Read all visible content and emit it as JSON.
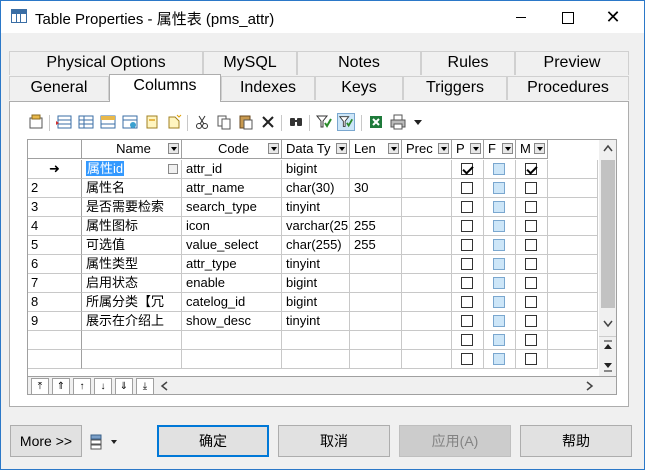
{
  "window": {
    "title": "Table Properties - 属性表 (pms_attr)",
    "close_glyph": "✕"
  },
  "tabs_row1": [
    "Physical Options",
    "MySQL",
    "Notes",
    "Rules",
    "Preview"
  ],
  "tabs_row2": [
    "General",
    "Columns",
    "Indexes",
    "Keys",
    "Triggers",
    "Procedures"
  ],
  "active_tab": "Columns",
  "toolbar_icons": [
    "properties-icon",
    "insert-row-icon",
    "add-row-icon",
    "add-columns-icon",
    "reuse-columns-icon",
    "new-item-icon",
    "cut-icon",
    "copy-icon",
    "paste-icon",
    "delete-icon",
    "find-icon",
    "filter-icon",
    "clear-filter-icon",
    "excel-export-icon",
    "print-icon",
    "dropdown-arrow-icon"
  ],
  "columns": {
    "headers": [
      "Name",
      "Code",
      "Data Ty",
      "Len",
      "Prec",
      "P",
      "F",
      "M"
    ],
    "rows": [
      {
        "num": "➜",
        "name": "属性id",
        "code": "attr_id",
        "type": "bigint",
        "len": "",
        "p": true,
        "m": true
      },
      {
        "num": "2",
        "name": "属性名",
        "code": "attr_name",
        "type": "char(30)",
        "len": "30",
        "p": false,
        "m": false
      },
      {
        "num": "3",
        "name": "是否需要检索",
        "code": "search_type",
        "type": "tinyint",
        "len": "",
        "p": false,
        "m": false
      },
      {
        "num": "4",
        "name": "属性图标",
        "code": "icon",
        "type": "varchar(25",
        "len": "255",
        "p": false,
        "m": false
      },
      {
        "num": "5",
        "name": "可选值",
        "code": "value_select",
        "type": "char(255)",
        "len": "255",
        "p": false,
        "m": false
      },
      {
        "num": "6",
        "name": "属性类型",
        "code": "attr_type",
        "type": "tinyint",
        "len": "",
        "p": false,
        "m": false
      },
      {
        "num": "7",
        "name": "启用状态",
        "code": "enable",
        "type": "bigint",
        "len": "",
        "p": false,
        "m": false
      },
      {
        "num": "8",
        "name": "所属分类【冗",
        "code": "catelog_id",
        "type": "bigint",
        "len": "",
        "p": false,
        "m": false
      },
      {
        "num": "9",
        "name": "展示在介绍上",
        "code": "show_desc",
        "type": "tinyint",
        "len": "",
        "p": false,
        "m": false
      }
    ]
  },
  "buttons": {
    "more": "More >>",
    "ok": "确定",
    "cancel": "取消",
    "apply": "应用(A)",
    "help": "帮助"
  },
  "colors": {
    "selection": "#3399ff",
    "window_border": "#2b78c8",
    "checkbox_blue": "#cde6f8"
  }
}
